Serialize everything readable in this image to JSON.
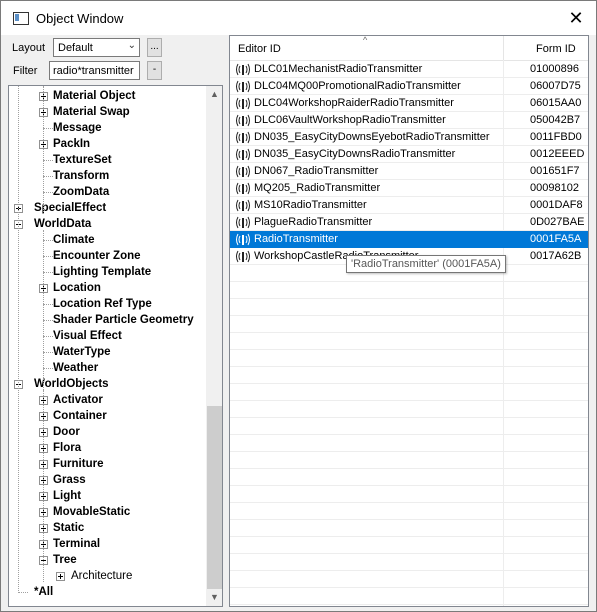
{
  "window": {
    "title": "Object Window",
    "close_glyph": "✕"
  },
  "toolbar": {
    "layout_label": "Layout",
    "layout_value": "Default",
    "layout_more": "...",
    "filter_label": "Filter",
    "filter_value": "radio*transmitter",
    "filter_btn": "-"
  },
  "tree": {
    "rows": [
      {
        "label": "Material Object",
        "indent": 2,
        "expander": "plus"
      },
      {
        "label": "Material Swap",
        "indent": 2,
        "expander": "plus"
      },
      {
        "label": "Message",
        "indent": 2,
        "expander": "none"
      },
      {
        "label": "PackIn",
        "indent": 2,
        "expander": "plus"
      },
      {
        "label": "TextureSet",
        "indent": 2,
        "expander": "none"
      },
      {
        "label": "Transform",
        "indent": 2,
        "expander": "none"
      },
      {
        "label": "ZoomData",
        "indent": 2,
        "expander": "none"
      },
      {
        "label": "SpecialEffect",
        "indent": 1,
        "expander": "plus"
      },
      {
        "label": "WorldData",
        "indent": 1,
        "expander": "minus"
      },
      {
        "label": "Climate",
        "indent": 2,
        "expander": "none"
      },
      {
        "label": "Encounter Zone",
        "indent": 2,
        "expander": "none"
      },
      {
        "label": "Lighting Template",
        "indent": 2,
        "expander": "none"
      },
      {
        "label": "Location",
        "indent": 2,
        "expander": "plus"
      },
      {
        "label": "Location Ref Type",
        "indent": 2,
        "expander": "none"
      },
      {
        "label": "Shader Particle Geometry",
        "indent": 2,
        "expander": "none"
      },
      {
        "label": "Visual Effect",
        "indent": 2,
        "expander": "none"
      },
      {
        "label": "WaterType",
        "indent": 2,
        "expander": "none"
      },
      {
        "label": "Weather",
        "indent": 2,
        "expander": "none"
      },
      {
        "label": "WorldObjects",
        "indent": 1,
        "expander": "minus"
      },
      {
        "label": "Activator",
        "indent": 2,
        "expander": "plus"
      },
      {
        "label": "Container",
        "indent": 2,
        "expander": "plus"
      },
      {
        "label": "Door",
        "indent": 2,
        "expander": "plus"
      },
      {
        "label": "Flora",
        "indent": 2,
        "expander": "plus"
      },
      {
        "label": "Furniture",
        "indent": 2,
        "expander": "plus"
      },
      {
        "label": "Grass",
        "indent": 2,
        "expander": "plus"
      },
      {
        "label": "Light",
        "indent": 2,
        "expander": "plus"
      },
      {
        "label": "MovableStatic",
        "indent": 2,
        "expander": "plus"
      },
      {
        "label": "Static",
        "indent": 2,
        "expander": "plus"
      },
      {
        "label": "Terminal",
        "indent": 2,
        "expander": "plus"
      },
      {
        "label": "Tree",
        "indent": 2,
        "expander": "minus"
      },
      {
        "label": "Architecture",
        "indent": 3,
        "expander": "plus",
        "normal": true
      },
      {
        "label": "*All",
        "indent": 1,
        "expander": "none"
      }
    ]
  },
  "list": {
    "col_editor_id": "Editor ID",
    "col_form_id": "Form ID",
    "sort_glyph": "^",
    "rows": [
      {
        "editor_id": "DLC01MechanistRadioTransmitter",
        "form_id": "01000896"
      },
      {
        "editor_id": "DLC04MQ00PromotionalRadioTransmitter",
        "form_id": "06007D75"
      },
      {
        "editor_id": "DLC04WorkshopRaiderRadioTransmitter",
        "form_id": "06015AA0"
      },
      {
        "editor_id": "DLC06VaultWorkshopRadioTransmitter",
        "form_id": "050042B7"
      },
      {
        "editor_id": "DN035_EasyCityDownsEyebotRadioTransmitter",
        "form_id": "0011FBD0"
      },
      {
        "editor_id": "DN035_EasyCityDownsRadioTransmitter",
        "form_id": "0012EEED"
      },
      {
        "editor_id": "DN067_RadioTransmitter",
        "form_id": "001651F7"
      },
      {
        "editor_id": "MQ205_RadioTransmitter",
        "form_id": "00098102"
      },
      {
        "editor_id": "MS10RadioTransmitter",
        "form_id": "0001DAF8"
      },
      {
        "editor_id": "PlagueRadioTransmitter",
        "form_id": "0D027BAE"
      },
      {
        "editor_id": "RadioTransmitter",
        "form_id": "0001FA5A",
        "selected": true
      },
      {
        "editor_id": "WorkshopCastleRadioTransmitter",
        "form_id": "0017A62B"
      }
    ],
    "tooltip": "'RadioTransmitter' (0001FA5A)",
    "row_icon": "radio-transmitter-icon",
    "selection_color": "#0078d7"
  }
}
